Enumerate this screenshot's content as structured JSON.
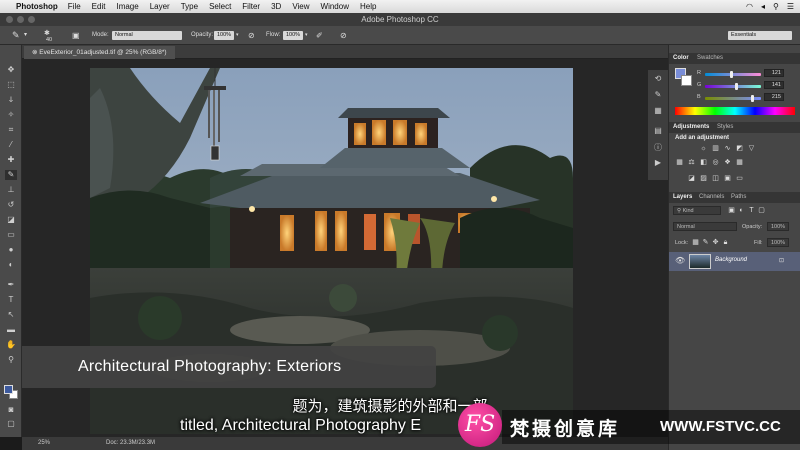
{
  "menubar": {
    "app_name": "Photoshop",
    "items": [
      "File",
      "Edit",
      "Image",
      "Layer",
      "Type",
      "Select",
      "Filter",
      "3D",
      "View",
      "Window",
      "Help"
    ]
  },
  "titlebar": {
    "title": "Adobe Photoshop CC"
  },
  "options": {
    "brush_size": "40",
    "mode_label": "Mode:",
    "mode_value": "Normal",
    "opacity_label": "Opacity:",
    "opacity_value": "100%",
    "flow_label": "Flow:",
    "flow_value": "100%",
    "workspace": "Essentials"
  },
  "document": {
    "tab_title": "EveExterior_01adjusted.tif @ 25% (RGB/8*)",
    "zoom": "25%",
    "doc_size": "Doc: 23.3M/23.3M"
  },
  "color_panel": {
    "tabs": [
      "Color",
      "Swatches"
    ],
    "channels": [
      {
        "label": "R",
        "value": "121",
        "thumb": 0.47
      },
      {
        "label": "G",
        "value": "141",
        "thumb": 0.55
      },
      {
        "label": "B",
        "value": "215",
        "thumb": 0.84
      }
    ],
    "foreground": "#798dd7"
  },
  "adjustments_panel": {
    "tabs": [
      "Adjustments",
      "Styles"
    ],
    "heading": "Add an adjustment"
  },
  "layers_panel": {
    "tabs": [
      "Layers",
      "Channels",
      "Paths"
    ],
    "kind_label": "Kind",
    "blend_mode": "Normal",
    "opacity_label": "Opacity:",
    "opacity_value": "100%",
    "lock_label": "Lock:",
    "fill_label": "Fill:",
    "fill_value": "100%",
    "layers": [
      {
        "name": "Background"
      }
    ]
  },
  "overlay": {
    "lower_third": "Architectural Photography: Exteriors",
    "subtitle_cn": "题为，建筑摄影的外部和一部",
    "subtitle_en": "titled, Architectural Photography E",
    "watermark_logo": "FS",
    "watermark_cn": "梵摄创意库",
    "watermark_url": "WWW.FSTVC.CC"
  }
}
